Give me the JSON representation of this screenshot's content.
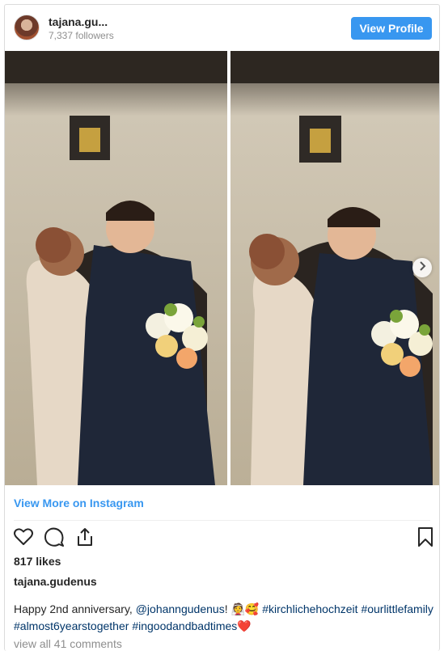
{
  "header": {
    "username": "tajana.gu...",
    "followers": "7,337 followers",
    "view_profile_label": "View Profile"
  },
  "media": {
    "carousel_next_icon": "chevron-right-icon"
  },
  "view_more_label": "View More on Instagram",
  "actions": {
    "like_icon": "heart-icon",
    "comment_icon": "comment-icon",
    "share_icon": "share-icon",
    "save_icon": "bookmark-icon"
  },
  "likes": "817 likes",
  "owner": "tajana.gudenus",
  "caption": {
    "text_start": "Happy 2nd anniversary, ",
    "mention": "@johanngudenus",
    "text_mid": "! 👰🥰 ",
    "tag1": "#kirchlichehochzeit",
    "tag2": "#ourlittlefamily",
    "tag3": "#almost6yearstogether",
    "tag4": "#ingoodandbadtimes",
    "emoji_end": "❤️"
  },
  "comments_link": "view all 41 comments",
  "colors": {
    "accent": "#3897f0",
    "link": "#003569",
    "muted": "#8e8e8e"
  }
}
